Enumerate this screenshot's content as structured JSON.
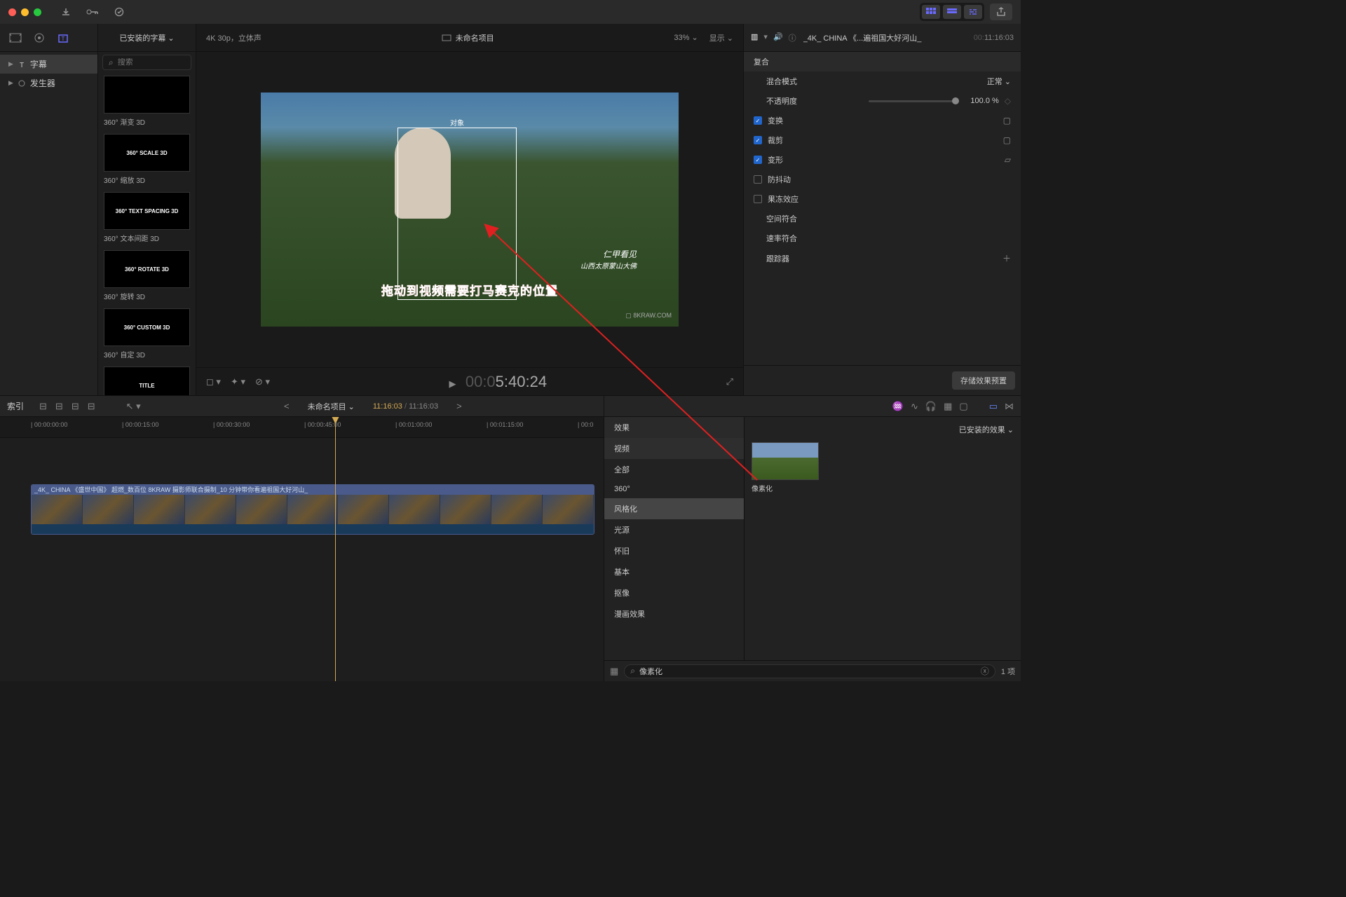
{
  "titlebar": {
    "traffic": [
      "#ff5f56",
      "#ffbd2e",
      "#27c93f"
    ]
  },
  "library": {
    "items": [
      {
        "label": "字幕",
        "selected": true
      },
      {
        "label": "发生器",
        "selected": false
      }
    ]
  },
  "browser": {
    "dropdown": "已安装的字幕",
    "search_placeholder": "搜索",
    "presets": [
      {
        "thumb": "",
        "label": "360° 渐变 3D"
      },
      {
        "thumb": "360° SCALE 3D",
        "label": "360° 缩放 3D"
      },
      {
        "thumb": "360° TEXT SPACING 3D",
        "label": "360° 文本间距 3D"
      },
      {
        "thumb": "360° ROTATE 3D",
        "label": "360° 旋转 3D"
      },
      {
        "thumb": "360° CUSTOM 3D",
        "label": "360° 自定 3D"
      },
      {
        "thumb": "TITLE",
        "label": ""
      }
    ]
  },
  "viewer": {
    "format": "4K 30p，立体声",
    "project": "未命名项目",
    "zoom": "33%",
    "display": "显示",
    "selection_label": "对象",
    "overlay": "拖动到视频需要打马赛克的位置",
    "script1": "仁甲看见",
    "script2": "山西太原蒙山大佛",
    "watermark": "8KRAW.COM",
    "timecode": "5:40:24",
    "timecode_prefix": "00:0"
  },
  "inspector": {
    "clip_name": "_4K_ CHINA 《...遍祖国大好河山_",
    "timecode": "11:16:03",
    "timecode_prefix": "00:",
    "section": "复合",
    "rows": {
      "blend_mode": {
        "label": "混合模式",
        "value": "正常"
      },
      "opacity": {
        "label": "不透明度",
        "value": "100.0 %"
      },
      "transform": {
        "label": "变换"
      },
      "crop": {
        "label": "裁剪"
      },
      "distort": {
        "label": "变形"
      },
      "stabilize": {
        "label": "防抖动"
      },
      "rolling": {
        "label": "果冻效应"
      },
      "spatial": {
        "label": "空间符合"
      },
      "rate": {
        "label": "速率符合"
      },
      "tracker": {
        "label": "跟踪器"
      }
    },
    "save_btn": "存储效果预置"
  },
  "timeline": {
    "index_btn": "索引",
    "project_name": "未命名项目",
    "time_current": "11:16:03",
    "time_total": "11:16:03",
    "ruler": [
      "00:00:00:00",
      "00:00:15:00",
      "00:00:30:00",
      "00:00:45:00",
      "00:01:00:00",
      "00:01:15:00",
      "00:0"
    ],
    "clip_title": "_4K_ CHINA 《盛世中国》 超燃_数百位 8KRAW 摄影师联合摄制_10 分钟带你看遍祖国大好河山_"
  },
  "effects": {
    "header": "已安装的效果",
    "categories": [
      {
        "label": "效果",
        "type": "hdr"
      },
      {
        "label": "视频",
        "type": "sub"
      },
      {
        "label": "全部",
        "type": "item"
      },
      {
        "label": "360°",
        "type": "item"
      },
      {
        "label": "风格化",
        "type": "sel"
      },
      {
        "label": "光源",
        "type": "item"
      },
      {
        "label": "怀旧",
        "type": "item"
      },
      {
        "label": "基本",
        "type": "item"
      },
      {
        "label": "抠像",
        "type": "item"
      },
      {
        "label": "漫画效果",
        "type": "item"
      }
    ],
    "thumb_label": "像素化",
    "search_value": "像素化",
    "count": "1 项"
  }
}
